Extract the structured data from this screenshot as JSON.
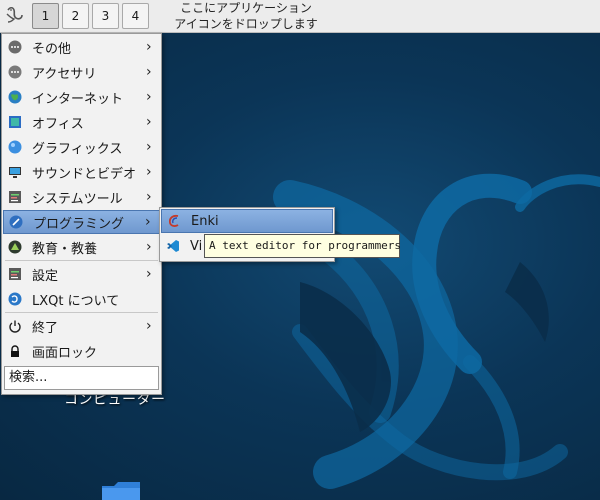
{
  "panel": {
    "workspaces": [
      "1",
      "2",
      "3",
      "4"
    ],
    "active_workspace": "1",
    "quicklaunch_hint_line1": "ここにアプリケーション",
    "quicklaunch_hint_line2": "アイコンをドロップします"
  },
  "desktop": {
    "computer_label": "コンピューター"
  },
  "menu": {
    "items": [
      {
        "label": "その他",
        "icon": "more-dots-icon",
        "submenu": true
      },
      {
        "label": "アクセサリ",
        "icon": "accessories-icon",
        "submenu": true
      },
      {
        "label": "インターネット",
        "icon": "globe-icon",
        "submenu": true
      },
      {
        "label": "オフィス",
        "icon": "office-icon",
        "submenu": true
      },
      {
        "label": "グラフィックス",
        "icon": "graphics-icon",
        "submenu": true
      },
      {
        "label": "サウンドとビデオ",
        "icon": "monitor-icon",
        "submenu": true
      },
      {
        "label": "システムツール",
        "icon": "system-tools-icon",
        "submenu": true
      },
      {
        "label": "プログラミング",
        "icon": "programming-icon",
        "submenu": true
      },
      {
        "label": "教育・教養",
        "icon": "education-icon",
        "submenu": true
      },
      {
        "label": "設定",
        "icon": "settings-icon",
        "submenu": true
      },
      {
        "label": "LXQt について",
        "icon": "lxqt-logo-icon",
        "submenu": false
      },
      {
        "label": "終了",
        "icon": "power-icon",
        "submenu": true
      },
      {
        "label": "画面ロック",
        "icon": "lock-icon",
        "submenu": false
      }
    ],
    "search_text": "検索..."
  },
  "submenu": {
    "items": [
      {
        "label": "Enki",
        "icon": "enki-icon"
      },
      {
        "label": "Vi",
        "icon": "vscode-icon"
      }
    ]
  },
  "tooltip": {
    "text": "A text editor for programmers"
  },
  "colors": {
    "highlight": "#7aa3d8",
    "desktop_bg": "#0b3557"
  }
}
